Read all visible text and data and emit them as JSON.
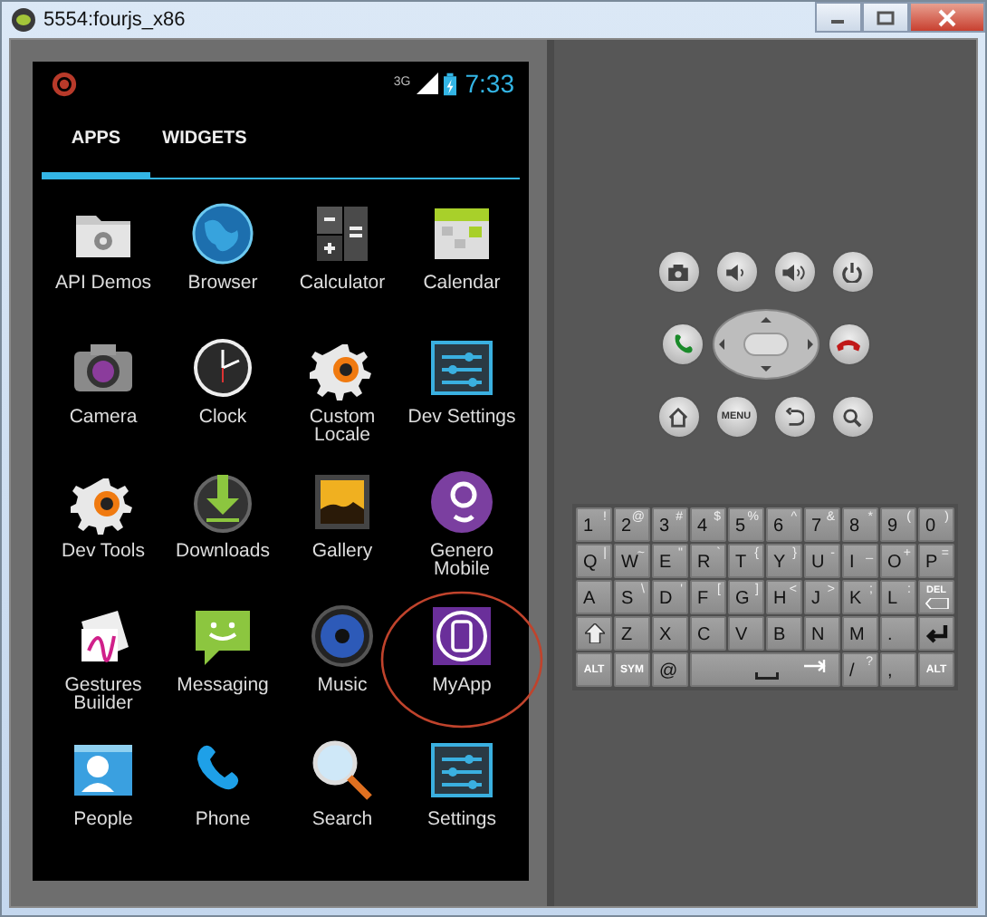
{
  "window": {
    "title": "5554:fourjs_x86"
  },
  "status_bar": {
    "network": "3G",
    "time": "7:33"
  },
  "tabs": [
    {
      "label": "APPS",
      "selected": true
    },
    {
      "label": "WIDGETS",
      "selected": false
    }
  ],
  "apps": [
    {
      "label": "API Demos",
      "circled": false
    },
    {
      "label": "Browser",
      "circled": false
    },
    {
      "label": "Calculator",
      "circled": false
    },
    {
      "label": "Calendar",
      "circled": false
    },
    {
      "label": "Camera",
      "circled": false
    },
    {
      "label": "Clock",
      "circled": false
    },
    {
      "label": "Custom Locale",
      "circled": false
    },
    {
      "label": "Dev Settings",
      "circled": false
    },
    {
      "label": "Dev Tools",
      "circled": false
    },
    {
      "label": "Downloads",
      "circled": false
    },
    {
      "label": "Gallery",
      "circled": false
    },
    {
      "label": "Genero Mobile",
      "circled": false
    },
    {
      "label": "Gestures Builder",
      "circled": false
    },
    {
      "label": "Messaging",
      "circled": false
    },
    {
      "label": "Music",
      "circled": false
    },
    {
      "label": "MyApp",
      "circled": true
    },
    {
      "label": "People",
      "circled": false
    },
    {
      "label": "Phone",
      "circled": false
    },
    {
      "label": "Search",
      "circled": false
    },
    {
      "label": "Settings",
      "circled": false
    }
  ],
  "controls": {
    "menu_label": "MENU"
  },
  "keyboard": {
    "rows": [
      [
        {
          "kind": "char",
          "main": "1",
          "alt": "!"
        },
        {
          "kind": "char",
          "main": "2",
          "alt": "@"
        },
        {
          "kind": "char",
          "main": "3",
          "alt": "#"
        },
        {
          "kind": "char",
          "main": "4",
          "alt": "$"
        },
        {
          "kind": "char",
          "main": "5",
          "alt": "%"
        },
        {
          "kind": "char",
          "main": "6",
          "alt": "^"
        },
        {
          "kind": "char",
          "main": "7",
          "alt": "&"
        },
        {
          "kind": "char",
          "main": "8",
          "alt": "*"
        },
        {
          "kind": "char",
          "main": "9",
          "alt": "("
        },
        {
          "kind": "char",
          "main": "0",
          "alt": ")"
        }
      ],
      [
        {
          "kind": "char",
          "main": "Q",
          "alt": "|"
        },
        {
          "kind": "char",
          "main": "W",
          "alt": "~"
        },
        {
          "kind": "char",
          "main": "E",
          "alt": "\""
        },
        {
          "kind": "char",
          "main": "R",
          "alt": "`"
        },
        {
          "kind": "char",
          "main": "T",
          "alt": "{"
        },
        {
          "kind": "char",
          "main": "Y",
          "alt": "}"
        },
        {
          "kind": "char",
          "main": "U",
          "alt": "-"
        },
        {
          "kind": "char",
          "main": "I",
          "alt": "_"
        },
        {
          "kind": "char",
          "main": "O",
          "alt": "+"
        },
        {
          "kind": "char",
          "main": "P",
          "alt": "="
        }
      ],
      [
        {
          "kind": "char",
          "main": "A"
        },
        {
          "kind": "char",
          "main": "S",
          "alt": "\\"
        },
        {
          "kind": "char",
          "main": "D",
          "alt": "'"
        },
        {
          "kind": "char",
          "main": "F",
          "alt": "["
        },
        {
          "kind": "char",
          "main": "G",
          "alt": "]"
        },
        {
          "kind": "char",
          "main": "H",
          "alt": "<"
        },
        {
          "kind": "char",
          "main": "J",
          "alt": ">"
        },
        {
          "kind": "char",
          "main": "K",
          "alt": ";"
        },
        {
          "kind": "char",
          "main": "L",
          "alt": ":"
        },
        {
          "kind": "del",
          "main": "DEL"
        }
      ],
      [
        {
          "kind": "shift"
        },
        {
          "kind": "char",
          "main": "Z"
        },
        {
          "kind": "char",
          "main": "X"
        },
        {
          "kind": "char",
          "main": "C"
        },
        {
          "kind": "char",
          "main": "V"
        },
        {
          "kind": "char",
          "main": "B"
        },
        {
          "kind": "char",
          "main": "N"
        },
        {
          "kind": "char",
          "main": "M"
        },
        {
          "kind": "char",
          "main": "."
        },
        {
          "kind": "enter"
        }
      ],
      [
        {
          "kind": "label",
          "main": "ALT"
        },
        {
          "kind": "label",
          "main": "SYM"
        },
        {
          "kind": "char",
          "main": "@"
        },
        {
          "kind": "space"
        },
        "",
        "",
        "",
        {
          "kind": "char",
          "main": "/",
          "alt": "?"
        },
        {
          "kind": "char",
          "main": ","
        },
        {
          "kind": "label",
          "main": "ALT"
        }
      ]
    ]
  }
}
